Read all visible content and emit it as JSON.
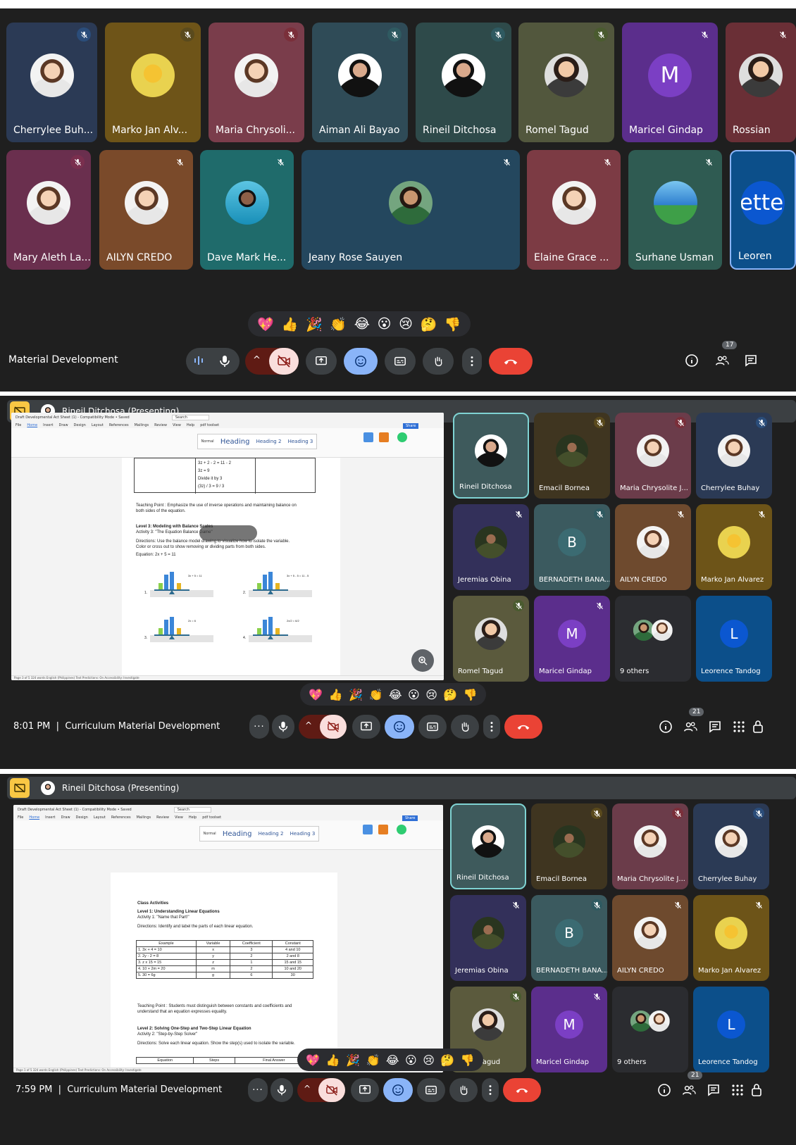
{
  "panel1": {
    "meeting_title": "Material Development",
    "participants_count": "17",
    "tiles": [
      {
        "name": "Cherrylee Buh...",
        "avatar": "face2",
        "bg": "#2b3a55"
      },
      {
        "name": "Marko Jan Alv...",
        "avatar": "sun",
        "bg": "#6e5418"
      },
      {
        "name": "Maria Chrysoli...",
        "avatar": "face2",
        "bg": "#7a3d4b"
      },
      {
        "name": "Aiman Ali Bayao",
        "avatar": "suit",
        "bg": "#2f4b57"
      },
      {
        "name": "Rineil Ditchosa",
        "avatar": "suit",
        "bg": "#2e4a4a"
      },
      {
        "name": "Romel Tagud",
        "avatar": "face",
        "bg": "#52573d"
      },
      {
        "name": "Maricel Gindap",
        "avatar": "M",
        "bg": "#5b2e8c"
      },
      {
        "name": "Rossian",
        "avatar": "face",
        "bg": "#6a2f36"
      },
      {
        "name": "Mary Aleth La...",
        "avatar": "face2",
        "bg": "#6a2f4e"
      },
      {
        "name": "AILYN CREDO",
        "avatar": "face2",
        "bg": "#7a4a2a"
      },
      {
        "name": "Dave Mark He...",
        "avatar": "sea",
        "bg": "#1f6b6b"
      },
      {
        "name": "Jeany Rose Sauyen",
        "avatar": "green",
        "bg": "#24475e"
      },
      {
        "name": "Elaine Grace ...",
        "avatar": "face2",
        "bg": "#7c3b44"
      },
      {
        "name": "Surhane Usman",
        "avatar": "group",
        "bg": "#2f5b52"
      },
      {
        "name": "Leoren",
        "avatar": "letter",
        "bg": "#0c4f8a"
      }
    ],
    "reactions": [
      "💖",
      "👍",
      "🎉",
      "👏",
      "😂",
      "😮",
      "😢",
      "🤔",
      "👎"
    ]
  },
  "panel2": {
    "time": "8:01 PM",
    "meeting_title": "Curriculum Material Development",
    "presenter": "Rineil Ditchosa (Presenting)",
    "participants_count": "21",
    "tiles": [
      {
        "name": "Rineil Ditchosa",
        "avatar": "suit"
      },
      {
        "name": "Emacil Bornea",
        "avatar": "army"
      },
      {
        "name": "Maria Chrysolite J...",
        "avatar": "face2"
      },
      {
        "name": "Cherrylee Buhay",
        "avatar": "face2"
      },
      {
        "name": "Jeremias Obina",
        "avatar": "army"
      },
      {
        "name": "BERNADETH BANA...",
        "avatar": "B"
      },
      {
        "name": "AILYN CREDO",
        "avatar": "face2"
      },
      {
        "name": "Marko Jan Alvarez",
        "avatar": "sun"
      },
      {
        "name": "Romel Tagud",
        "avatar": "face"
      },
      {
        "name": "Maricel Gindap",
        "avatar": "M"
      },
      {
        "name": "9 others",
        "avatar": "others"
      },
      {
        "name": "Leorence Tandog",
        "avatar": "L"
      }
    ],
    "doc": {
      "window_title": "Draft Developmental Act Sheet (1) - Compatibility Mode • Saved",
      "search": "Search",
      "menu": [
        "File",
        "Home",
        "Insert",
        "Draw",
        "Design",
        "Layout",
        "References",
        "Mailings",
        "Review",
        "View",
        "Help",
        "pdf toolset"
      ],
      "styles": [
        "Normal",
        "Heading",
        "Heading 2",
        "Heading 3"
      ],
      "comments": "Comments",
      "editing": "Editing",
      "share": "Share",
      "lines_top": [
        "3z + 2 - 2 = 11 - 2",
        "3z = 9",
        "Divide it by 3",
        "(3z) / 3 = 9 / 3"
      ],
      "teaching_point": "Teaching Point : Emphasize the use of inverse operations and maintaining balance on",
      "teaching_point2": "both sides of the equation.",
      "level3": "Level 3: Modeling with Balance Scales",
      "activity3": "Activity 3: \"The Equation Balance Game\"",
      "directions3": "Directions: Use the balance model drawing to visualize how to isolate the variable.",
      "directions3b": "Color or cross out to show removing or dividing parts from both sides.",
      "equation": "Equation: 2x + 5 = 11",
      "scale_labels": [
        "3x + 5 = 11",
        "3x + 5 - 5 = 11 - 5",
        "2x = 6",
        "2x/2 = 6/2"
      ],
      "scale_nums": [
        "1.",
        "2.",
        "3.",
        "4."
      ],
      "status": "Page 3 of 5    324 words    English (Philippines)    Text Predictions: On    Accessibility: Investigate"
    }
  },
  "panel3": {
    "time": "7:59 PM",
    "meeting_title": "Curriculum Material Development",
    "presenter": "Rineil Ditchosa (Presenting)",
    "participants_count": "21",
    "doc": {
      "class_activities": "Class Activities",
      "level1": "Level 1: Understanding Linear Equations",
      "activity1": "Activity 1: \"Name that Part!\"",
      "directions1": "Directions: Identify and label the parts of each linear equation.",
      "table_headers": [
        "Example",
        "Variable",
        "Coefficient",
        "Constant"
      ],
      "table_rows": [
        [
          "1. 3x + 4 = 10",
          "x",
          "3",
          "4 and 10"
        ],
        [
          "2. 2y - 2 = 8",
          "y",
          "2",
          "2 and 8"
        ],
        [
          "3. z x 15 = 15",
          "z",
          "1",
          "15 and 15"
        ],
        [
          "4. 10 + 2m = 20",
          "m",
          "2",
          "10 and 20"
        ],
        [
          "5. 30 = 6g",
          "g",
          "6",
          "30"
        ]
      ],
      "teaching_point": "Teaching Point : Students must distinguish between constants and coefficients and",
      "teaching_point2": "understand that an equation expresses equality.",
      "level2": "Level 2: Solving One-Step and Two-Step Linear Equation",
      "activity2": "Activity 2: \"Step-by-Step Solver\"",
      "directions2": "Directions: Solve each linear equation. Show the step(s) used to isolate the variable.",
      "bottom_headers": [
        "Equation",
        "Steps",
        "Final Answer"
      ],
      "status": "Page 1 of 5    324 words    English (Philippines)    Text Predictions: On    Accessibility: Investigate"
    }
  },
  "colors": {
    "accent": "#8ab4f8",
    "end_call": "#ea4335",
    "cam_off": "#f9dedc",
    "present_bar": "#f9c744"
  }
}
